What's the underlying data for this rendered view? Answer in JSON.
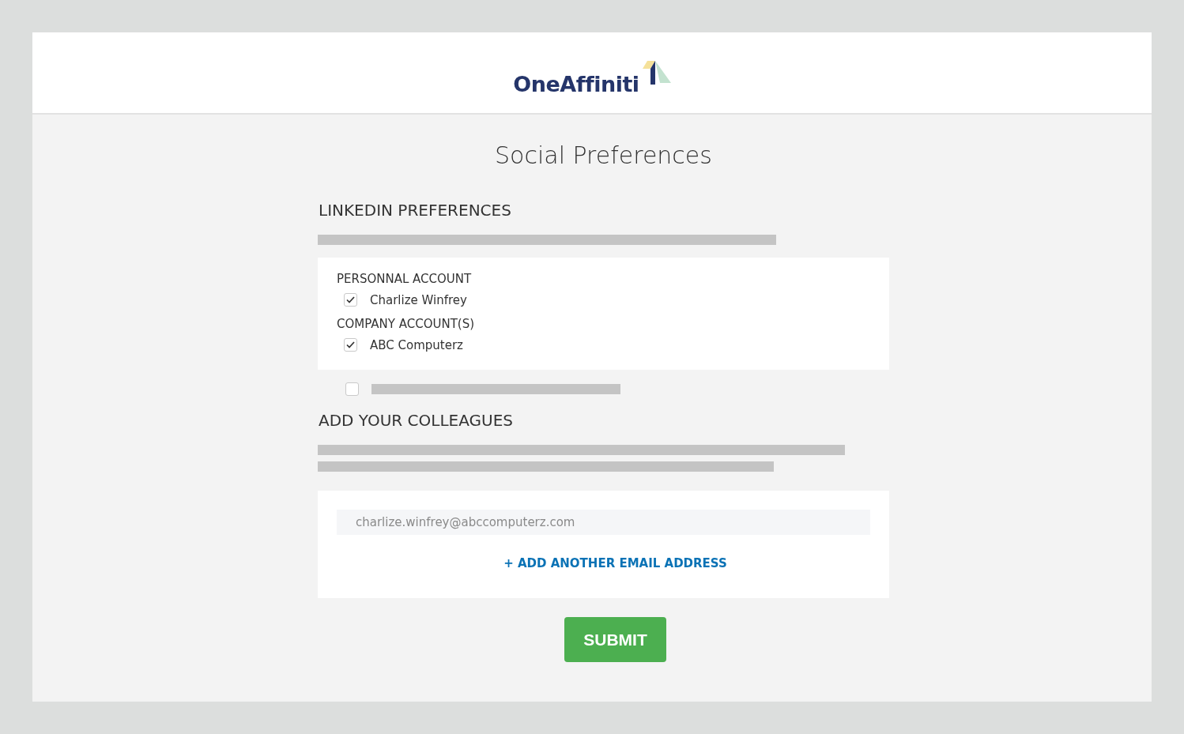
{
  "header": {
    "logo_text": "OneAffiniti"
  },
  "title": "Social Preferences",
  "linkedin": {
    "heading": "LINKEDIN PREFERENCES",
    "groups": [
      {
        "label": "PERSONNAL ACCOUNT",
        "accounts": [
          {
            "name": "Charlize Winfrey",
            "checked": true
          }
        ]
      },
      {
        "label": "COMPANY ACCOUNT(S)",
        "accounts": [
          {
            "name": "ABC Computerz",
            "checked": true
          }
        ]
      }
    ],
    "opt_in": {
      "checked": false
    }
  },
  "colleagues": {
    "heading": "ADD YOUR COLLEAGUES",
    "emails": [
      {
        "value": "charlize.winfrey@abccomputerz.com"
      }
    ],
    "add_link": "+ ADD ANOTHER EMAIL ADDRESS"
  },
  "submit": "SUBMIT"
}
